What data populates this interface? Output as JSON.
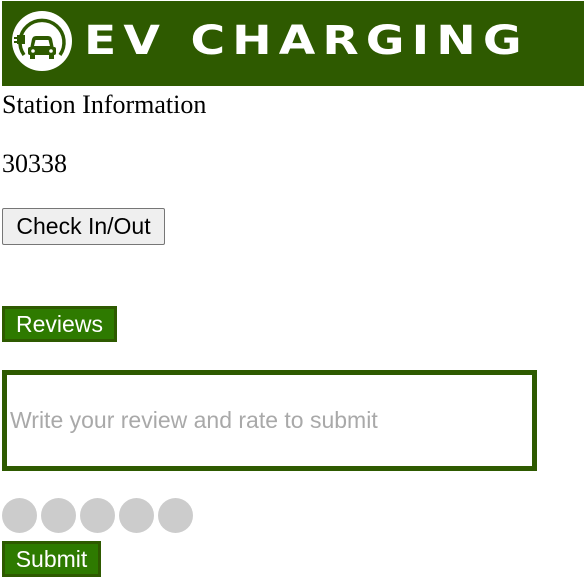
{
  "header": {
    "brand_text": "EV CHARGING",
    "logo_icon": "ev-car-plug-icon",
    "background_color": "#2e5a00"
  },
  "station": {
    "heading": "Station Information",
    "zip": "30338"
  },
  "actions": {
    "check_in_out_label": "Check In/Out",
    "reviews_label": "Reviews",
    "submit_label": "Submit"
  },
  "review": {
    "placeholder": "Write your review and rate to submit",
    "value": ""
  },
  "rating": {
    "max": 5,
    "value": 0,
    "inactive_color": "#cccccc"
  },
  "colors": {
    "accent_green": "#2e7a00",
    "dark_green": "#2e5a00"
  }
}
